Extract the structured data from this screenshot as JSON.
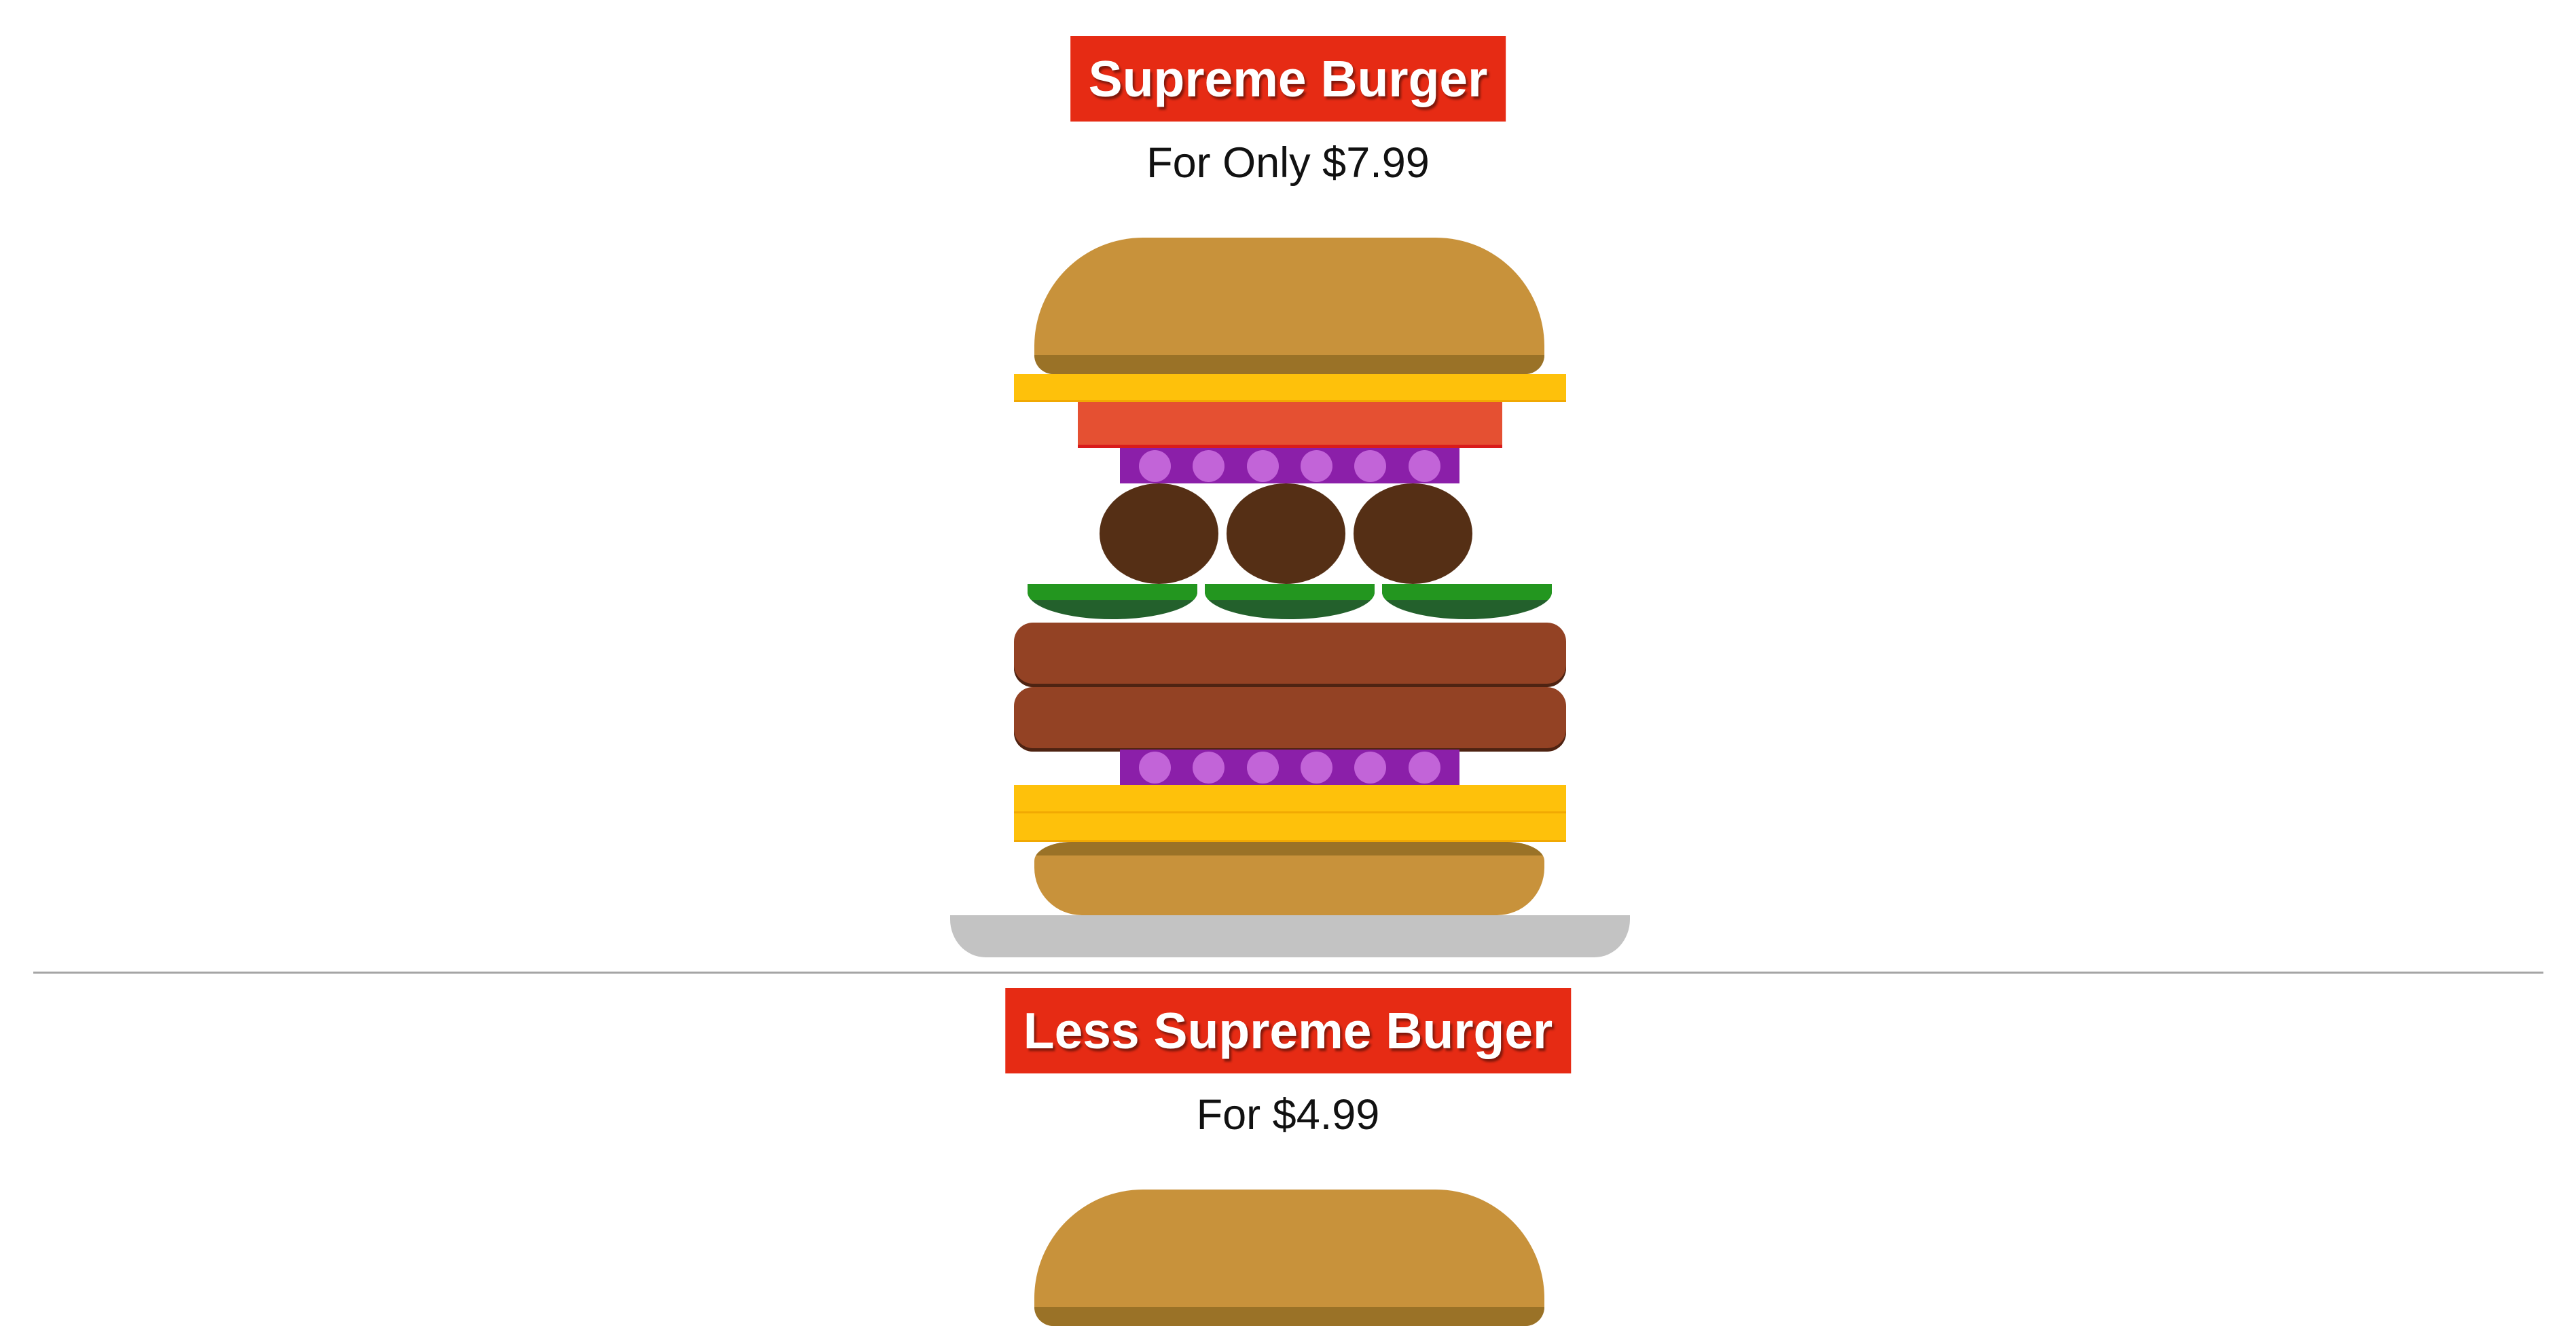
{
  "menu": [
    {
      "title": "Supreme Burger",
      "price_text": "For Only $7.99"
    },
    {
      "title": "Less Supreme Burger",
      "price_text": "For $4.99"
    }
  ],
  "colors": {
    "title_background": "#e62b14",
    "title_text": "#ffffff",
    "bun": "#c8923b",
    "bun_shadow": "#9a7227",
    "cheese": "#fec10b",
    "tomato": "#e55032",
    "onion": "#8b1fa9",
    "onion_dots": "#c264d8",
    "meatball": "#552f15",
    "pickle_top": "#23961f",
    "pickle_bottom": "#23602c",
    "patty": "#934224",
    "plate": "#c3c3c3",
    "divider": "#a5a5a5"
  },
  "burger_layers": [
    "bun-top",
    "cheese",
    "tomato",
    "onion",
    "meatballs",
    "pickles",
    "patty",
    "patty",
    "onion",
    "cheese",
    "cheese",
    "bun-bottom",
    "plate"
  ]
}
